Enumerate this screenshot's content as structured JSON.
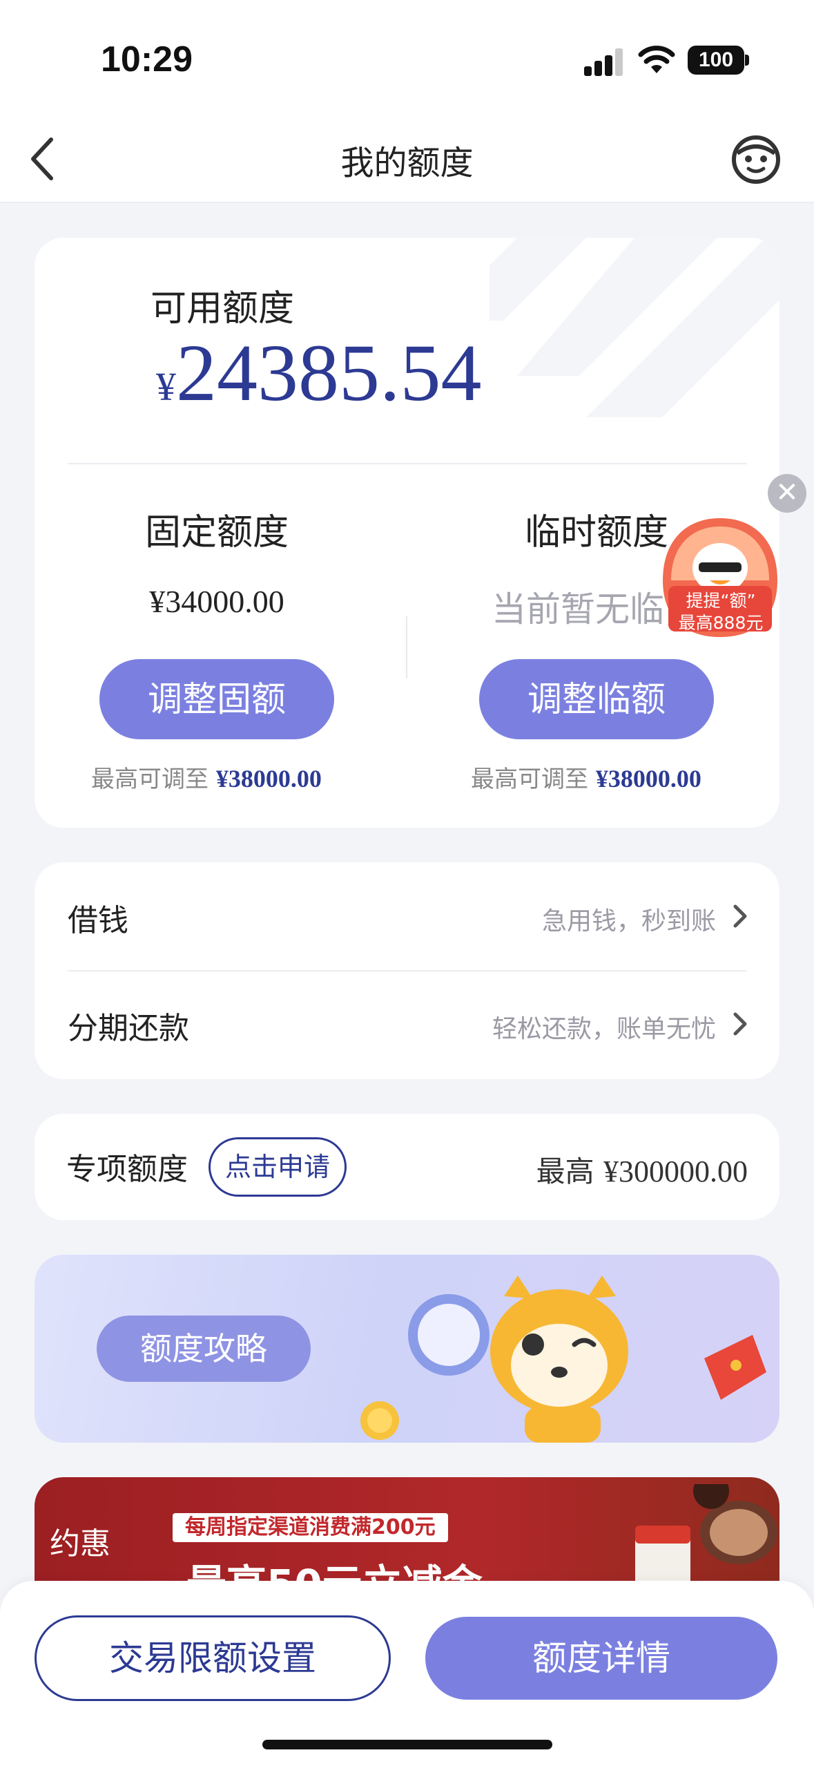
{
  "status_bar": {
    "time": "10:29",
    "battery": "100"
  },
  "header": {
    "title": "我的额度"
  },
  "quota_card": {
    "available_label": "可用额度",
    "available_currency": "¥",
    "available_amount": "24385.54",
    "fixed": {
      "title": "固定额度",
      "value": "¥34000.00",
      "button": "调整固额",
      "max_prefix": "最高可调至 ",
      "max_value": "¥38000.00"
    },
    "temporary": {
      "title": "临时额度",
      "value": "当前暂无临",
      "button": "调整临额",
      "max_prefix": "最高可调至 ",
      "max_value": "¥38000.00"
    }
  },
  "float_badge": {
    "close": "✕",
    "text_line1": "提提“额”",
    "text_line2": "最高888元"
  },
  "list": [
    {
      "title": "借钱",
      "subtitle": "急用钱，秒到账"
    },
    {
      "title": "分期还款",
      "subtitle": "轻松还款，账单无忧"
    }
  ],
  "special": {
    "title": "专项额度",
    "apply": "点击申请",
    "max_prefix": "最高 ",
    "max_value": "¥300000.00"
  },
  "banner": {
    "label": "额度攻略"
  },
  "promo": {
    "logo": "约惠",
    "tag": "每周指定渠道消费满200元",
    "headline": "最高50元立减金"
  },
  "bottom": {
    "left_button": "交易限额设置",
    "right_button": "额度详情"
  },
  "colors": {
    "accent": "#7b80e0",
    "navy": "#2c3a93",
    "background": "#f3f4f8",
    "promo_red": "#b1282a"
  }
}
